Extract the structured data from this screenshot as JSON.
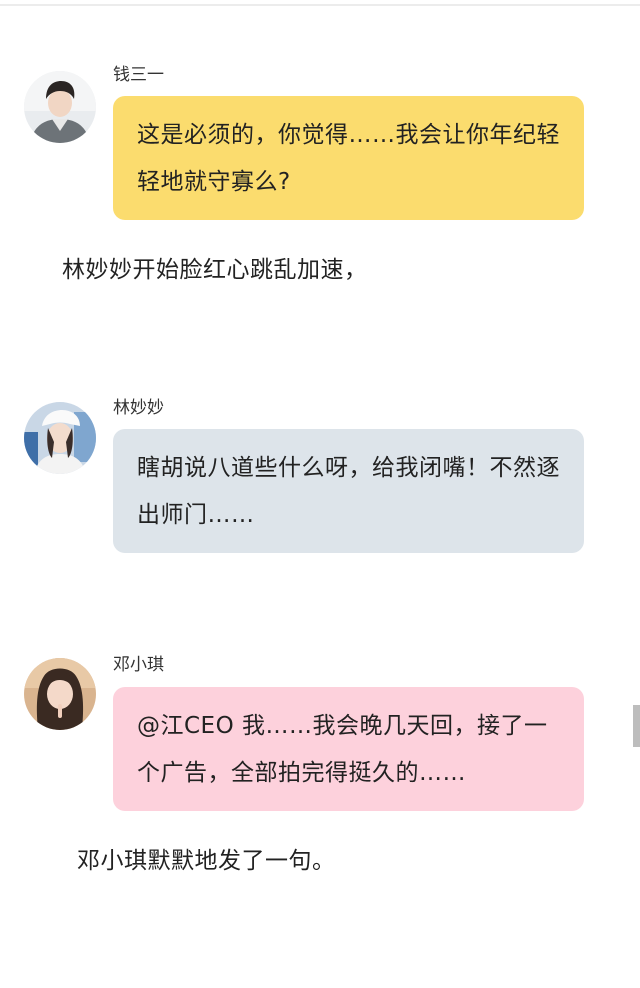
{
  "messages": [
    {
      "sender": "钱三一",
      "text": "这是必须的，你觉得……我会让你年纪轻轻地就守寡么?",
      "bubble_color": "#fbdc6e",
      "avatar": "avatar-young-man-gray-jacket"
    },
    {
      "sender": "林妙妙",
      "text": "瞎胡说八道些什么呀，给我闭嘴！不然逐出师门……",
      "bubble_color": "#dde4ea",
      "avatar": "avatar-girl-white-cap"
    },
    {
      "sender": "邓小琪",
      "text": "@江CEO  我……我会晚几天回，接了一个广告，全部拍完得挺久的……",
      "bubble_color": "#fdd1dc",
      "avatar": "avatar-girl-long-hair"
    }
  ],
  "narrations": [
    "林妙妙开始脸红心跳乱加速，",
    "邓小琪默默地发了一句。"
  ]
}
